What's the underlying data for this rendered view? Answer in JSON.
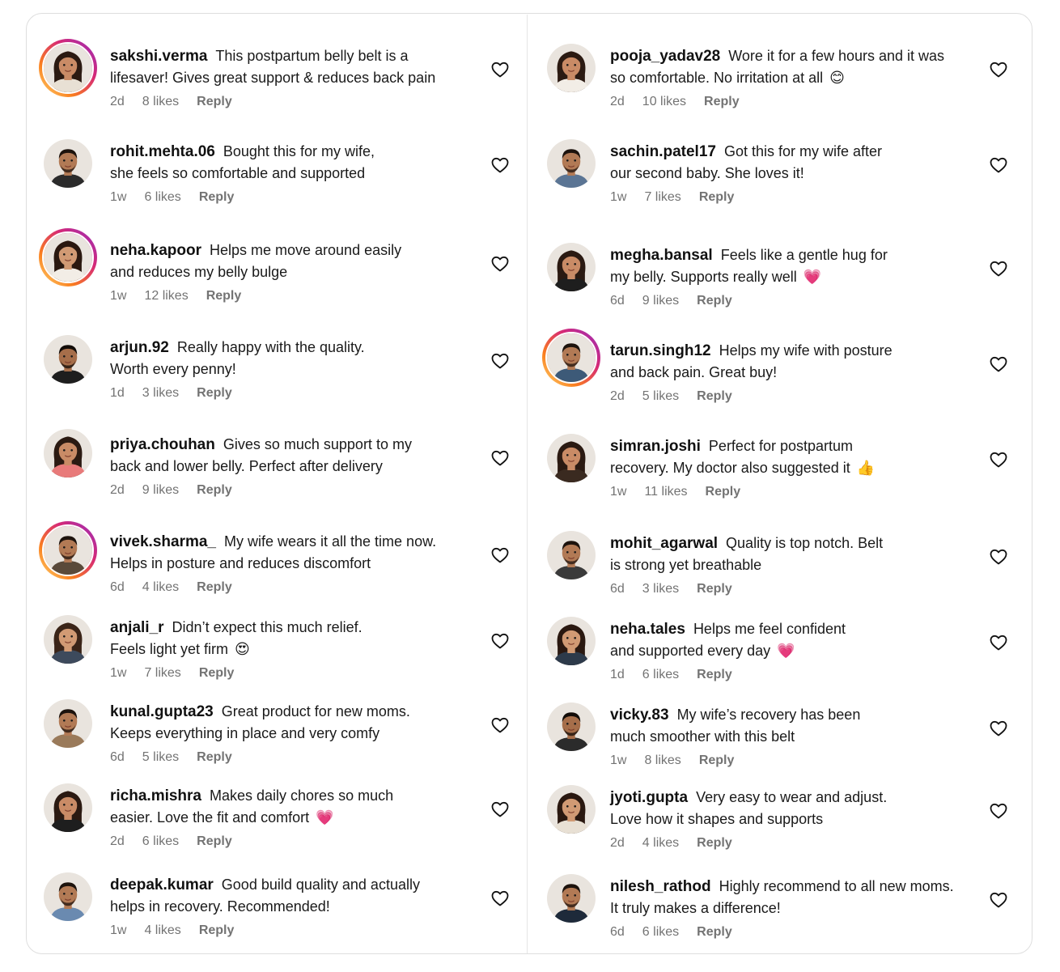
{
  "left": [
    {
      "user": "sakshi.verma",
      "l1": "This postpartum belly belt is a",
      "l2": "lifesaver! Gives great support & reduces back pain",
      "emoji": "",
      "time": "2d",
      "likes": "8 likes",
      "reply": "Reply",
      "story": true,
      "skin": "#c98b66",
      "hair": "#2b1a12",
      "shirt": "#e8e0d4",
      "gender": "f"
    },
    {
      "user": "rohit.mehta.06",
      "l1": "Bought this for my wife,",
      "l2": "she feels so comfortable and supported",
      "emoji": "",
      "time": "1w",
      "likes": "6 likes",
      "reply": "Reply",
      "story": false,
      "skin": "#b27a55",
      "hair": "#1d130d",
      "shirt": "#2b2b2b",
      "gender": "m"
    },
    {
      "user": "neha.kapoor",
      "l1": "Helps me move around easily",
      "l2": "and reduces my belly bulge",
      "emoji": "",
      "time": "1w",
      "likes": "12 likes",
      "reply": "Reply",
      "story": true,
      "skin": "#d19a74",
      "hair": "#2a1810",
      "shirt": "#f2ede6",
      "gender": "f"
    },
    {
      "user": "arjun.92",
      "l1": "Really happy with the quality.",
      "l2": "Worth every penny!",
      "emoji": "",
      "time": "1d",
      "likes": "3 likes",
      "reply": "Reply",
      "story": false,
      "skin": "#a66e4a",
      "hair": "#120c08",
      "shirt": "#1e1e1e",
      "gender": "m"
    },
    {
      "user": "priya.chouhan",
      "l1": "Gives so much support to my",
      "l2": "back and lower belly. Perfect after delivery",
      "emoji": "",
      "time": "2d",
      "likes": "9 likes",
      "reply": "Reply",
      "story": false,
      "skin": "#c98b66",
      "hair": "#2b1a12",
      "shirt": "#e87a7a",
      "gender": "f"
    },
    {
      "user": "vivek.sharma_",
      "l1": "My wife wears it all the time now.",
      "l2": "Helps in posture and reduces discomfort",
      "emoji": "",
      "time": "6d",
      "likes": "4 likes",
      "reply": "Reply",
      "story": true,
      "skin": "#b27a55",
      "hair": "#1d130d",
      "shirt": "#5a4a3a",
      "gender": "m"
    },
    {
      "user": "anjali_r",
      "l1": "Didn’t expect this much relief.",
      "l2": "Feels light yet firm",
      "emoji": "😍",
      "time": "1w",
      "likes": "7 likes",
      "reply": "Reply",
      "story": false,
      "skin": "#d19a74",
      "hair": "#3a2418",
      "shirt": "#3d4a5c",
      "gender": "f"
    },
    {
      "user": "kunal.gupta23",
      "l1": "Great product for new moms.",
      "l2": "Keeps everything in place and very comfy",
      "emoji": "",
      "time": "6d",
      "likes": "5 likes",
      "reply": "Reply",
      "story": false,
      "skin": "#b27a55",
      "hair": "#1d130d",
      "shirt": "#9a7a5a",
      "gender": "m"
    },
    {
      "user": "richa.mishra",
      "l1": "Makes daily chores so much",
      "l2": "easier. Love the fit and comfort",
      "emoji": "💗",
      "time": "2d",
      "likes": "6 likes",
      "reply": "Reply",
      "story": false,
      "skin": "#c98b66",
      "hair": "#2b1a12",
      "shirt": "#1e1e1e",
      "gender": "f"
    },
    {
      "user": "deepak.kumar",
      "l1": "Good build quality and actually",
      "l2": "helps in recovery. Recommended!",
      "emoji": "",
      "time": "1w",
      "likes": "4 likes",
      "reply": "Reply",
      "story": false,
      "skin": "#b27a55",
      "hair": "#1d130d",
      "shirt": "#6a8ab0",
      "gender": "m"
    }
  ],
  "right": [
    {
      "user": "pooja_yadav28",
      "l1": "Wore it for a few hours and it was",
      "l2": "so comfortable. No irritation at all",
      "emoji": "😊",
      "time": "2d",
      "likes": "10 likes",
      "reply": "Reply",
      "story": false,
      "skin": "#c98b66",
      "hair": "#2b1a12",
      "shirt": "#f2ede6",
      "gender": "f"
    },
    {
      "user": "sachin.patel17",
      "l1": "Got this for my wife after",
      "l2": "our second baby. She loves it!",
      "emoji": "",
      "time": "1w",
      "likes": "7 likes",
      "reply": "Reply",
      "story": false,
      "skin": "#b27a55",
      "hair": "#1d130d",
      "shirt": "#5b7594",
      "gender": "m"
    },
    {
      "user": "megha.bansal",
      "l1": "Feels like a gentle hug for",
      "l2": "my belly. Supports really well",
      "emoji": "💗",
      "time": "6d",
      "likes": "9 likes",
      "reply": "Reply",
      "story": false,
      "skin": "#c98b66",
      "hair": "#2b1a12",
      "shirt": "#1e1e1e",
      "gender": "f"
    },
    {
      "user": "tarun.singh12",
      "l1": "Helps my wife with posture",
      "l2": "and back pain. Great buy!",
      "emoji": "",
      "time": "2d",
      "likes": "5 likes",
      "reply": "Reply",
      "story": true,
      "skin": "#b27a55",
      "hair": "#1d130d",
      "shirt": "#3d5a78",
      "gender": "m"
    },
    {
      "user": "simran.joshi",
      "l1": "Perfect for postpartum",
      "l2": "recovery. My doctor also suggested it",
      "emoji": "👍",
      "time": "1w",
      "likes": "11 likes",
      "reply": "Reply",
      "story": false,
      "skin": "#c98b66",
      "hair": "#2b1a12",
      "shirt": "#3a2a20",
      "gender": "f"
    },
    {
      "user": "mohit_agarwal",
      "l1": "Quality is top notch. Belt",
      "l2": "is strong yet breathable",
      "emoji": "",
      "time": "6d",
      "likes": "3 likes",
      "reply": "Reply",
      "story": false,
      "skin": "#b27a55",
      "hair": "#1d130d",
      "shirt": "#3a3a3a",
      "gender": "m"
    },
    {
      "user": "neha.tales",
      "l1": "Helps me feel confident",
      "l2": "and supported every day",
      "emoji": "💗",
      "time": "1d",
      "likes": "6 likes",
      "reply": "Reply",
      "story": false,
      "skin": "#d19a74",
      "hair": "#2a1810",
      "shirt": "#2d3a4a",
      "gender": "f"
    },
    {
      "user": "vicky.83",
      "l1": "My wife’s recovery has been",
      "l2": "much smoother with this belt",
      "emoji": "",
      "time": "1w",
      "likes": "8 likes",
      "reply": "Reply",
      "story": false,
      "skin": "#a66e4a",
      "hair": "#120c08",
      "shirt": "#2b2b2b",
      "gender": "m"
    },
    {
      "user": "jyoti.gupta",
      "l1": "Very easy to wear and adjust.",
      "l2": "Love how it shapes and supports",
      "emoji": "",
      "time": "2d",
      "likes": "4 likes",
      "reply": "Reply",
      "story": false,
      "skin": "#d19a74",
      "hair": "#2a1810",
      "shirt": "#e8e0d4",
      "gender": "f"
    },
    {
      "user": "nilesh_rathod",
      "l1": "Highly recommend to all new moms.",
      "l2": "It truly makes a difference!",
      "emoji": "",
      "time": "6d",
      "likes": "6 likes",
      "reply": "Reply",
      "story": false,
      "skin": "#b27a55",
      "hair": "#1d130d",
      "shirt": "#1e2a3a",
      "gender": "m"
    }
  ]
}
